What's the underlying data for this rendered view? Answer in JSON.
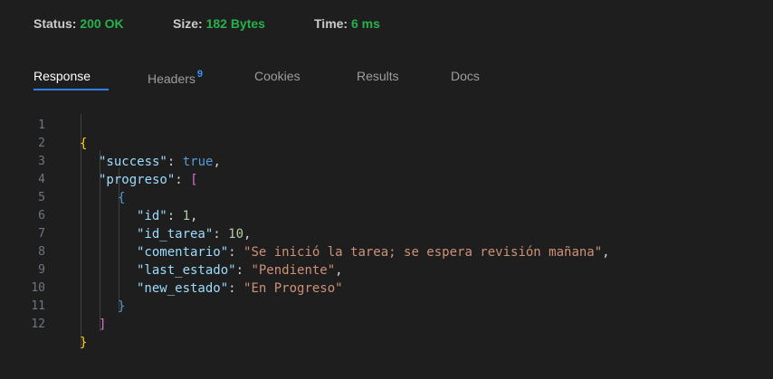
{
  "status_bar": {
    "status_label": "Status:",
    "status_value": "200 OK",
    "size_label": "Size:",
    "size_value": "182 Bytes",
    "time_label": "Time:",
    "time_value": "6 ms"
  },
  "tabs": [
    {
      "label": "Response",
      "active": true
    },
    {
      "label": "Headers",
      "badge": "9"
    },
    {
      "label": "Cookies"
    },
    {
      "label": "Results"
    },
    {
      "label": "Docs"
    }
  ],
  "colors": {
    "accent": "#2f80ed",
    "status_ok": "#27b14a",
    "json_key": "#9cdcfe",
    "json_string": "#ce9178",
    "json_number": "#b5cea8",
    "json_bool": "#569cd6"
  },
  "response": {
    "line_numbers": [
      "1",
      "2",
      "3",
      "4",
      "5",
      "6",
      "7",
      "8",
      "9",
      "10",
      "11",
      "12"
    ],
    "lines": {
      "l1": "{",
      "l2_key": "\"success\"",
      "l2_val": "true",
      "l3_key": "\"progreso\"",
      "l3_open": "[",
      "l4": "{",
      "l5_key": "\"id\"",
      "l5_val": "1",
      "l6_key": "\"id_tarea\"",
      "l6_val": "10",
      "l7_key": "\"comentario\"",
      "l7_val": "\"Se inició la tarea; se espera revisión mañana\"",
      "l8_key": "\"last_estado\"",
      "l8_val": "\"Pendiente\"",
      "l9_key": "\"new_estado\"",
      "l9_val": "\"En Progreso\"",
      "l10": "}",
      "l11": "]",
      "l12": "}"
    }
  }
}
